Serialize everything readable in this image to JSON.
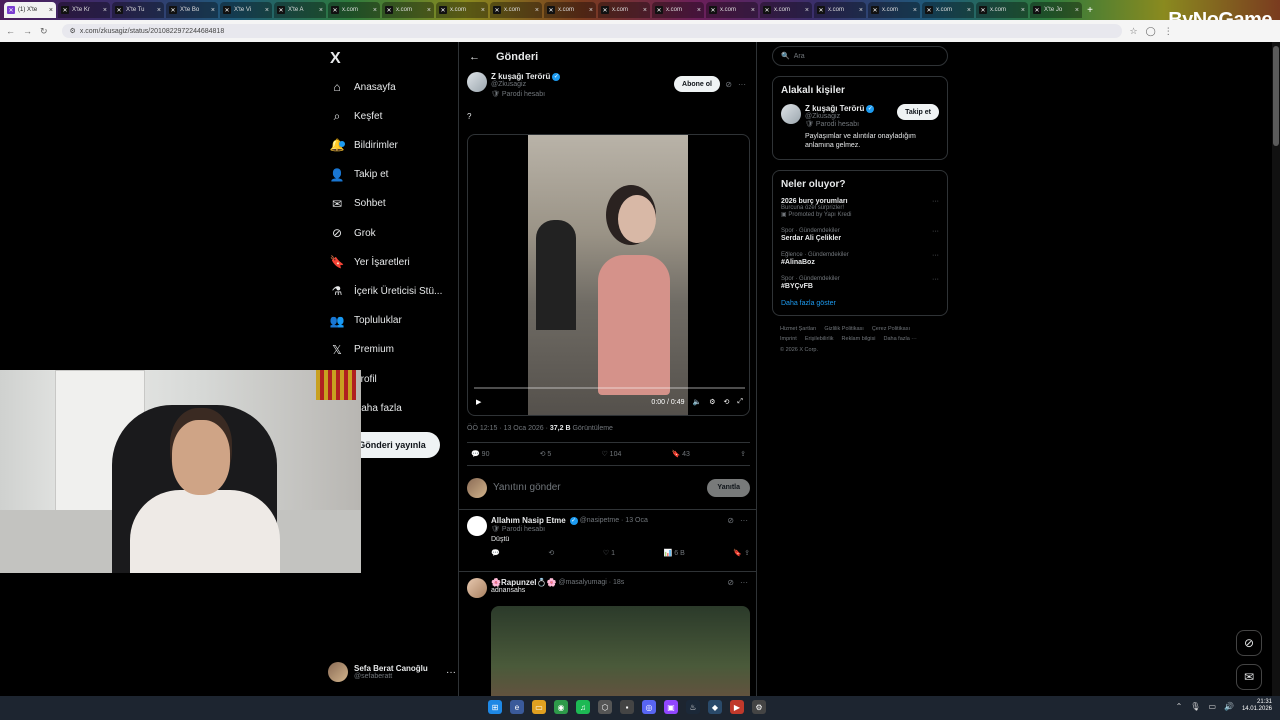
{
  "browser": {
    "active_tab": "(1) X'te",
    "tabs": [
      "X'te Kr",
      "X'te Tu",
      "X'te Bo",
      "X'te Vi",
      "X'te A",
      "x.com",
      "x.com",
      "x.com",
      "x.com",
      "x.com",
      "x.com",
      "x.com",
      "x.com",
      "x.com",
      "x.com",
      "x.com",
      "x.com",
      "x.com",
      "X'te Jo"
    ],
    "url": "x.com/zkusagiz/status/2010822972244684818",
    "brand": "ByNoGame"
  },
  "left_nav": {
    "logo": "X",
    "items": [
      {
        "label": "Anasayfa",
        "icon": "home-icon"
      },
      {
        "label": "Keşfet",
        "icon": "search-icon"
      },
      {
        "label": "Bildirimler",
        "icon": "bell-icon"
      },
      {
        "label": "Takip et",
        "icon": "person-add-icon"
      },
      {
        "label": "Sohbet",
        "icon": "mail-icon"
      },
      {
        "label": "Grok",
        "icon": "grok-icon"
      },
      {
        "label": "Yer İşaretleri",
        "icon": "bookmark-icon"
      },
      {
        "label": "İçerik Üreticisi Stü...",
        "icon": "flask-icon"
      },
      {
        "label": "Topluluklar",
        "icon": "people-icon"
      },
      {
        "label": "Premium",
        "icon": "x-premium-icon"
      },
      {
        "label": "Profil",
        "icon": "profile-icon"
      },
      {
        "label": "Daha fazla",
        "icon": "more-icon"
      }
    ],
    "post_button": "Gönderi yayınla",
    "user": {
      "name": "Sefa Berat Canoğlu",
      "handle": "@sefaberatt"
    }
  },
  "center": {
    "header": "Gönderi",
    "post": {
      "author": "Z kuşağı Terörü",
      "handle": "@Zkusagiz",
      "label": "Parodi hesabı",
      "subscribe": "Abone ol",
      "text": "?",
      "video_time": "0:00 / 0:49",
      "video_progress": 0,
      "timestamp": "ÖÖ 12:15 · 13 Oca 2026 ·",
      "views": "37,2 B",
      "views_label": "Görüntüleme",
      "replies": "90",
      "reposts": "5",
      "likes": "104",
      "bookmarks": "43"
    },
    "reply_box": {
      "placeholder": "Yanıtını gönder",
      "button": "Yanıtla"
    },
    "replies": [
      {
        "author": "Allahım Nasip Etme",
        "handle": "@nasipetme · 13 Oca",
        "label": "Parodi hesabı",
        "text": "Düştü",
        "reposts": "",
        "likes": "1",
        "views": "6 B"
      },
      {
        "author": "🌸Rapunzel💍🌸",
        "handle": "@masalyumagi · 18s",
        "text": "adnansahs"
      }
    ]
  },
  "right": {
    "search_placeholder": "Ara",
    "related": {
      "title": "Alakalı kişiler",
      "name": "Z kuşağı Terörü",
      "handle": "@Zkusagiz",
      "label": "Parodi hesabı",
      "follow": "Takip et",
      "bio": "Paylaşımlar ve alıntılar onayladığım anlamına gelmez."
    },
    "trends": {
      "title": "Neler oluyor?",
      "items": [
        {
          "context": "",
          "title": "2026 burç yorumları",
          "sub": "Burcuna özel sürprizler!",
          "promo": "Promoted by Yapı Kredi"
        },
        {
          "context": "Spor · Gündemdekiler",
          "title": "Serdar Ali Çelikler"
        },
        {
          "context": "Eğlence · Gündemdekiler",
          "title": "#AlinaBoz"
        },
        {
          "context": "Spor · Gündemdekiler",
          "title": "#BYÇvFB"
        }
      ],
      "show_more": "Daha fazla göster"
    },
    "footer": [
      "Hizmet Şartları",
      "Gizlilik Politikası",
      "Çerez Politikası",
      "Imprint",
      "Erişilebilirlik",
      "Reklam bilgisi",
      "Daha fazla ···",
      "© 2026 X Corp."
    ]
  },
  "taskbar": {
    "time": "21:31",
    "date": "14.01.2026"
  }
}
